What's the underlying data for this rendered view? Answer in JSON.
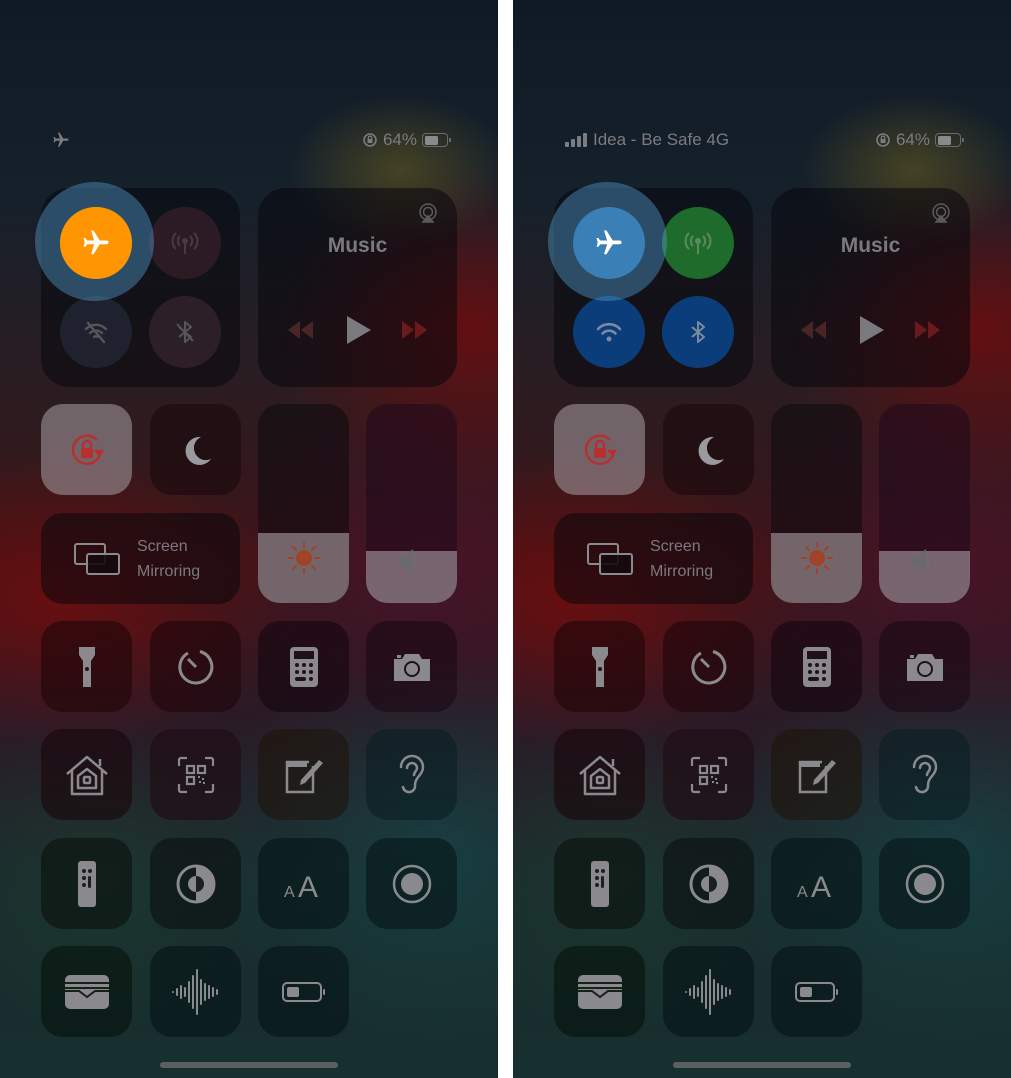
{
  "screens": [
    {
      "id": "left",
      "state": "airplane-mode-on",
      "status_bar": {
        "left_icon": "airplane-icon",
        "carrier": "",
        "rotation_lock_icon": "rotation-lock-icon",
        "battery_percent": "64%",
        "battery_level": 0.64
      },
      "connectivity": {
        "airplane": {
          "label": "Airplane Mode",
          "on": true,
          "color": "#ff9500"
        },
        "cellular": {
          "label": "Cellular Data",
          "on": false
        },
        "wifi": {
          "label": "Wi-Fi",
          "on": false
        },
        "bluetooth": {
          "label": "Bluetooth",
          "on": false
        }
      },
      "music": {
        "title": "Music"
      },
      "screen_mirroring": {
        "line1": "Screen",
        "line2": "Mirroring"
      },
      "brightness_level": 0.35,
      "volume_level": 0.26
    },
    {
      "id": "right",
      "state": "airplane-mode-off",
      "status_bar": {
        "left_icon": "signal-bars-icon",
        "carrier": "Idea - Be Safe 4G",
        "rotation_lock_icon": "rotation-lock-icon",
        "battery_percent": "64%",
        "battery_level": 0.64
      },
      "connectivity": {
        "airplane": {
          "label": "Airplane Mode",
          "on": false,
          "color": "#3a7fb5"
        },
        "cellular": {
          "label": "Cellular Data",
          "on": true,
          "color": "#1f6b2c"
        },
        "wifi": {
          "label": "Wi-Fi",
          "on": true,
          "color": "#0a3d7a"
        },
        "bluetooth": {
          "label": "Bluetooth",
          "on": true,
          "color": "#0a3d7a"
        }
      },
      "music": {
        "title": "Music"
      },
      "screen_mirroring": {
        "line1": "Screen",
        "line2": "Mirroring"
      },
      "brightness_level": 0.35,
      "volume_level": 0.26
    }
  ],
  "controls": [
    "rotation-lock",
    "do-not-disturb",
    "brightness",
    "volume",
    "screen-mirroring",
    "flashlight",
    "timer",
    "calculator",
    "camera",
    "home",
    "qr-code-scanner",
    "notes",
    "hearing",
    "apple-tv-remote",
    "dark-mode",
    "text-size",
    "screen-recording",
    "wallet",
    "voice-memos",
    "low-power-mode"
  ],
  "colors": {
    "airplane_on": "#ff9500",
    "cellular_on": "#1f6b2c",
    "wifi_bt_on": "#0a3d7a",
    "highlight": "#5096c8",
    "icon_gray": "#8a8a8e",
    "rotation_lock_red": "#c0392b"
  }
}
